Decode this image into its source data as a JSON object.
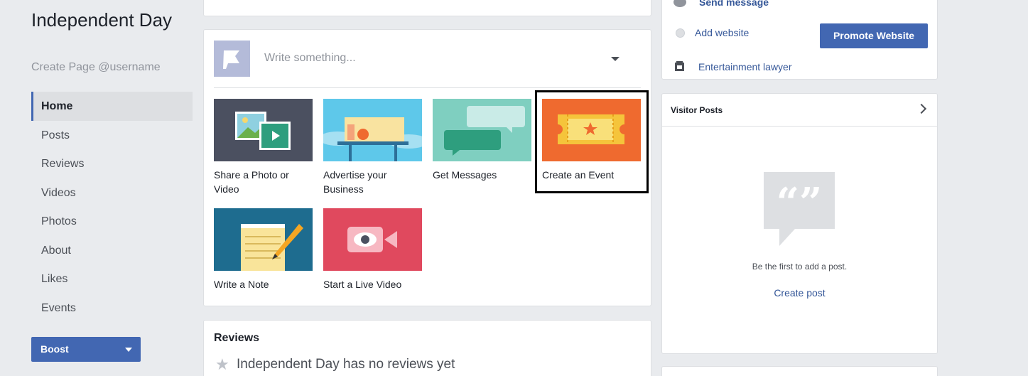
{
  "page": {
    "name": "Independent Day",
    "username": "Create Page @username"
  },
  "sidebar": {
    "items": [
      {
        "label": "Home",
        "active": true
      },
      {
        "label": "Posts"
      },
      {
        "label": "Reviews"
      },
      {
        "label": "Videos"
      },
      {
        "label": "Photos"
      },
      {
        "label": "About"
      },
      {
        "label": "Likes"
      },
      {
        "label": "Events"
      }
    ],
    "boost_label": "Boost"
  },
  "composer": {
    "placeholder": "Write something...",
    "tiles": [
      {
        "label": "Share a Photo or Video",
        "icon": "photo-video-icon",
        "color": "#4b5060"
      },
      {
        "label": "Advertise your Business",
        "icon": "advertise-icon",
        "color": "#5ec8ea"
      },
      {
        "label": "Get Messages",
        "icon": "messages-icon",
        "color": "#7fcfc0"
      },
      {
        "label": "Create an Event",
        "icon": "event-ticket-icon",
        "color": "#ef6a2f",
        "highlighted": true
      },
      {
        "label": "Write a Note",
        "icon": "note-icon",
        "color": "#1e6c8f"
      },
      {
        "label": "Start a Live Video",
        "icon": "live-video-icon",
        "color": "#e0495e"
      }
    ]
  },
  "reviews": {
    "title": "Reviews",
    "empty_text": "Independent Day has no reviews yet"
  },
  "right": {
    "send_message": "Send message",
    "add_website": "Add website",
    "promote_label": "Promote Website",
    "category": "Entertainment lawyer",
    "visitor_posts": {
      "title": "Visitor Posts",
      "empty_text": "Be the first to add a post.",
      "create_label": "Create post"
    }
  },
  "colors": {
    "brand_blue": "#4267b2",
    "link_blue": "#365899",
    "background": "#e9ebee"
  }
}
